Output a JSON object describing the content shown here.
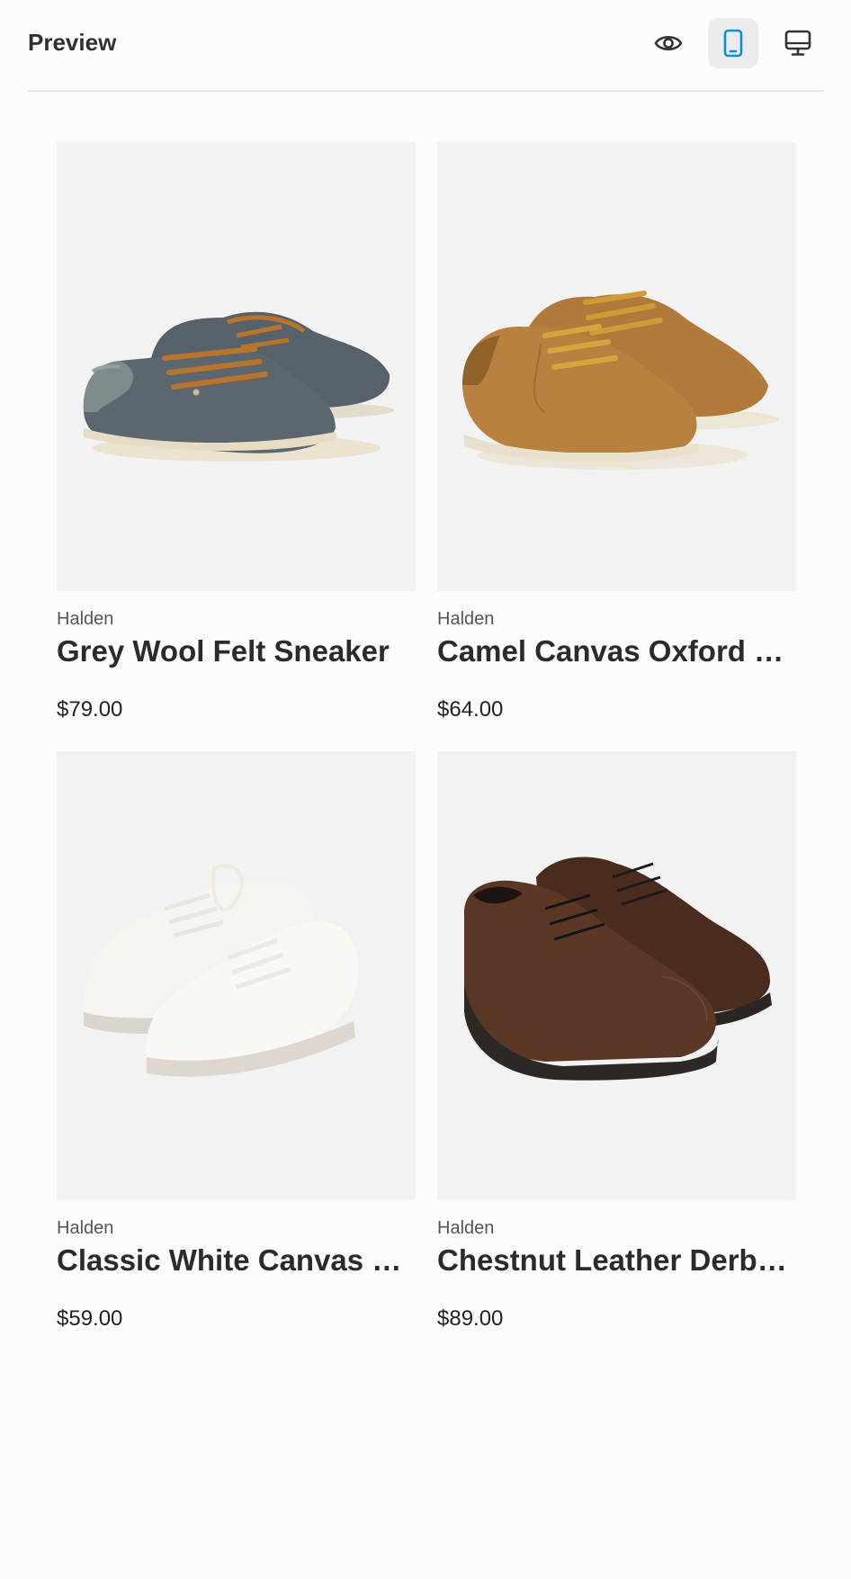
{
  "header": {
    "title": "Preview",
    "active_view": "mobile",
    "accent": "#0a90d8"
  },
  "products": [
    {
      "vendor": "Halden",
      "name": "Grey Wool Felt Sneaker",
      "price": "$79.00",
      "image": "grey-wool-sneakers"
    },
    {
      "vendor": "Halden",
      "name": "Camel Canvas Oxford Sneaker",
      "price": "$64.00",
      "image": "camel-canvas-sneakers"
    },
    {
      "vendor": "Halden",
      "name": "Classic White Canvas Sneaker",
      "price": "$59.00",
      "image": "white-canvas-sneakers"
    },
    {
      "vendor": "Halden",
      "name": "Chestnut Leather Derby Shoe",
      "price": "$89.00",
      "image": "brown-leather-derby"
    }
  ]
}
